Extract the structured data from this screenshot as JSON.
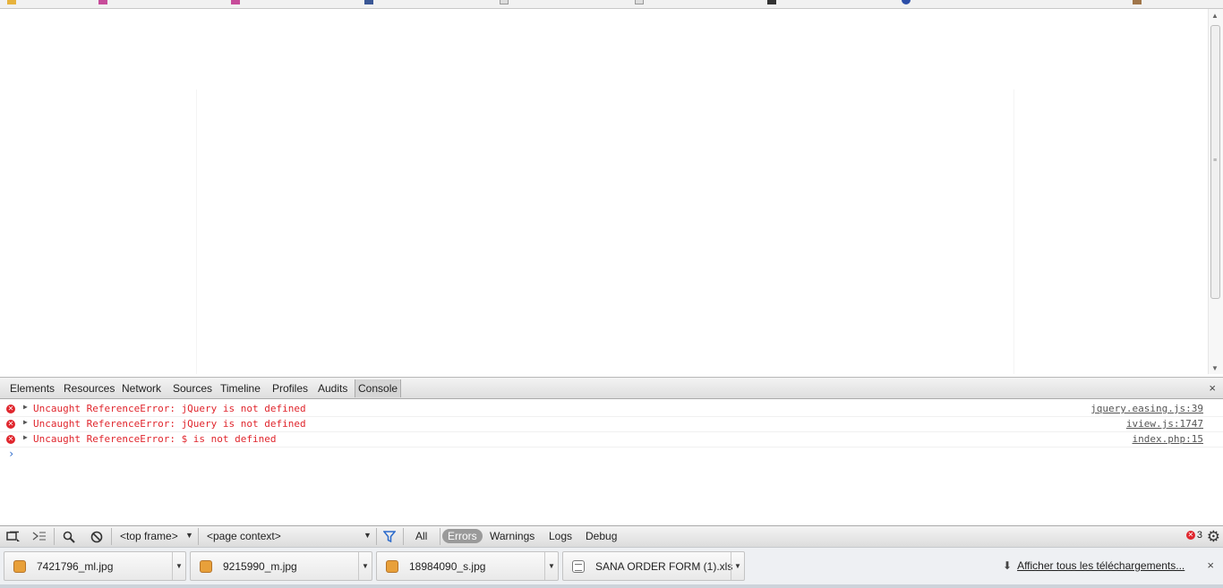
{
  "devtools": {
    "tabs": [
      {
        "label": "Elements"
      },
      {
        "label": "Resources"
      },
      {
        "label": "Network"
      },
      {
        "label": "Sources"
      },
      {
        "label": "Timeline"
      },
      {
        "label": "Profiles"
      },
      {
        "label": "Audits"
      },
      {
        "label": "Console",
        "active": true
      }
    ],
    "close_label": "×",
    "console": {
      "messages": [
        {
          "text": "Uncaught ReferenceError: jQuery is not defined",
          "source": "jquery.easing.js:39"
        },
        {
          "text": "Uncaught ReferenceError: jQuery is not defined",
          "source": "iview.js:1747"
        },
        {
          "text": "Uncaught ReferenceError: $ is not defined",
          "source": "index.php:15"
        }
      ],
      "prompt": "›"
    },
    "status_bar": {
      "frame_select": "<top frame>",
      "context_select": "<page context>",
      "filters": [
        {
          "label": "All"
        },
        {
          "label": "Errors",
          "active": true
        },
        {
          "label": "Warnings"
        },
        {
          "label": "Logs"
        },
        {
          "label": "Debug"
        }
      ],
      "error_count": "3"
    }
  },
  "downloads": {
    "items": [
      {
        "name": "7421796_ml.jpg",
        "icon": "image-file-icon"
      },
      {
        "name": "9215990_m.jpg",
        "icon": "image-file-icon"
      },
      {
        "name": "18984090_s.jpg",
        "icon": "image-file-icon"
      },
      {
        "name": "SANA ORDER FORM (1).xls",
        "icon": "spreadsheet-file-icon"
      }
    ],
    "show_all_label": "Afficher tous les téléchargements...",
    "close_label": "×"
  }
}
